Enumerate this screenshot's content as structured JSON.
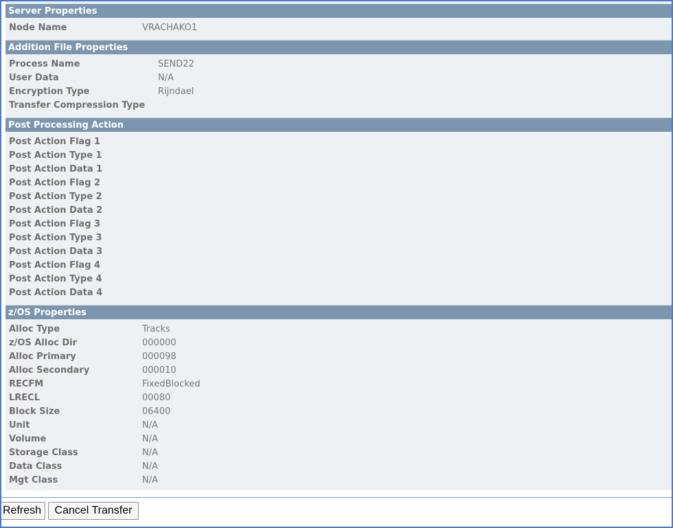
{
  "sections": {
    "server": {
      "title": "Server Properties",
      "rows": [
        {
          "label": "Node Name",
          "value": "VRACHAKO1"
        }
      ]
    },
    "addition": {
      "title": "Addition File Properties",
      "rows": [
        {
          "label": "Process Name",
          "value": "SEND22"
        },
        {
          "label": "User Data",
          "value": "N/A"
        },
        {
          "label": "Encryption Type",
          "value": "Rijndael"
        },
        {
          "label": "Transfer Compression Type",
          "value": ""
        }
      ]
    },
    "post": {
      "title": "Post Processing Action",
      "rows": [
        {
          "label": "Post Action Flag 1",
          "value": ""
        },
        {
          "label": "Post Action Type 1",
          "value": ""
        },
        {
          "label": "Post Action Data 1",
          "value": ""
        },
        {
          "label": "Post Action Flag 2",
          "value": ""
        },
        {
          "label": "Post Action Type 2",
          "value": ""
        },
        {
          "label": "Post Action Data 2",
          "value": ""
        },
        {
          "label": "Post Action Flag 3",
          "value": ""
        },
        {
          "label": "Post Action Type 3",
          "value": ""
        },
        {
          "label": "Post Action Data 3",
          "value": ""
        },
        {
          "label": "Post Action Flag 4",
          "value": ""
        },
        {
          "label": "Post Action Type 4",
          "value": ""
        },
        {
          "label": "Post Action Data 4",
          "value": ""
        }
      ]
    },
    "zos": {
      "title": "z/OS Properties",
      "rows": [
        {
          "label": "Alloc Type",
          "value": "Tracks"
        },
        {
          "label": "z/OS Alloc Dir",
          "value": "000000"
        },
        {
          "label": "Alloc Primary",
          "value": "000098"
        },
        {
          "label": "Alloc Secondary",
          "value": "000010"
        },
        {
          "label": "RECFM",
          "value": "FixedBlocked"
        },
        {
          "label": "LRECL",
          "value": "00080"
        },
        {
          "label": "Block Size",
          "value": "06400"
        },
        {
          "label": "Unit",
          "value": "N/A"
        },
        {
          "label": "Volume",
          "value": "N/A"
        },
        {
          "label": "Storage Class",
          "value": "N/A"
        },
        {
          "label": "Data Class",
          "value": "N/A"
        },
        {
          "label": "Mgt Class",
          "value": "N/A"
        }
      ]
    }
  },
  "buttons": {
    "refresh": "Refresh",
    "cancel": "Cancel Transfer"
  },
  "colors": {
    "section_header_bg": "#7b96ae",
    "content_bg": "#eef1f4",
    "frame_border": "#4a7bc4"
  }
}
